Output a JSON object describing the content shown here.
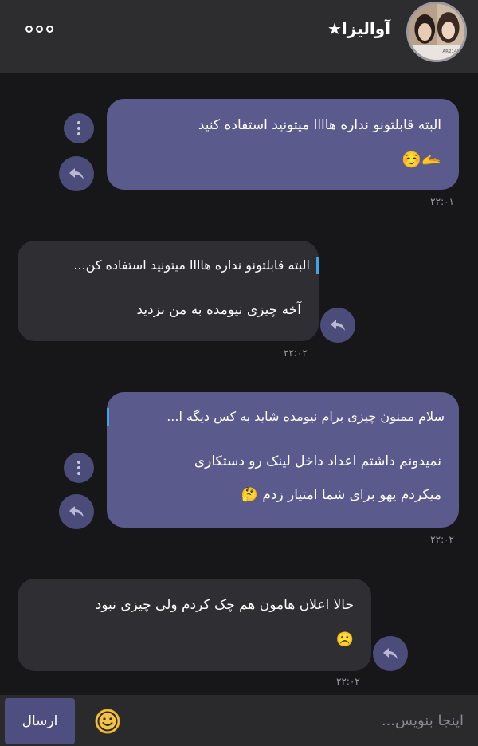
{
  "header": {
    "title": "آوالیزا★",
    "avatar_caption": "AR21420"
  },
  "messages": [
    {
      "id": "m1",
      "direction": "outgoing",
      "lines": [
        "البته قابلتونو نداره هاااا میتونید استفاده کنید",
        "🫴☺️"
      ],
      "time": "۲۲:۰۱"
    },
    {
      "id": "m2",
      "direction": "incoming",
      "reply_to": "البته قابلتونو نداره هاااا میتونید استفاده کن...",
      "lines": [
        "آخه چیزی نیومده به من نزدید"
      ],
      "time": "۲۲:۰۲"
    },
    {
      "id": "m3",
      "direction": "outgoing",
      "reply_to": "سلام ممنون چیزی برام نیومده شاید به کس دیگه ا...",
      "lines": [
        "نمیدونم داشتم اعداد داخل لینک رو دستکاری",
        "میکردم یهو برای شما امتیاز زدم 🤔"
      ],
      "time": "۲۲:۰۲"
    },
    {
      "id": "m4",
      "direction": "incoming",
      "lines": [
        "حالا اعلان هامون هم چک کردم ولی چیزی نبود",
        "☹️"
      ],
      "time": "۲۲:۰۲"
    }
  ],
  "composer": {
    "placeholder": "اینجا بنویس...",
    "send_label": "ارسال"
  },
  "colors": {
    "outgoing_bubble": "#5a5a8c",
    "incoming_bubble": "#2f2f33",
    "reply_accent": "#3fa4e8",
    "background": "#17171a"
  }
}
